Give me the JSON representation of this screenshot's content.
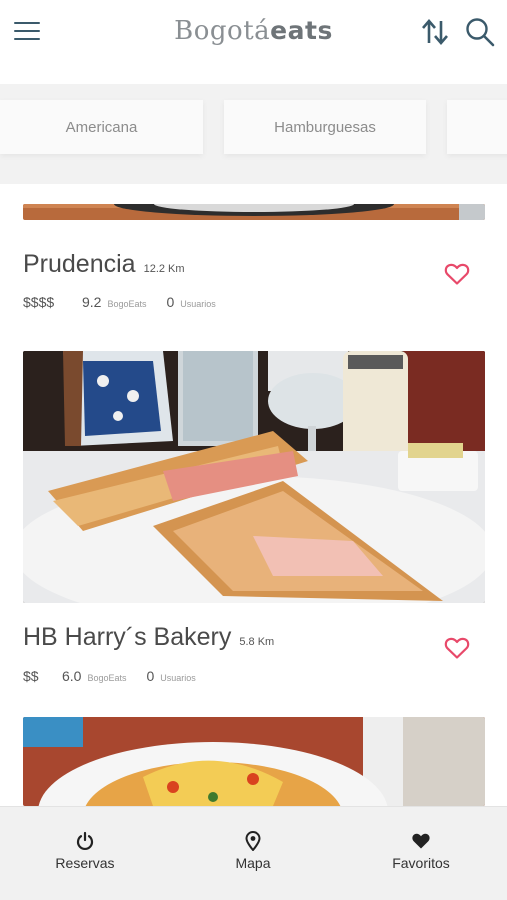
{
  "header": {
    "logo_light": "Bogotá",
    "logo_bold": "eats"
  },
  "categories": [
    {
      "label": "Americana"
    },
    {
      "label": "Hamburguesas"
    },
    {
      "label": ""
    }
  ],
  "restaurants": [
    {
      "name": "Prudencia",
      "distance": "12.2 Km",
      "price": "$$$$",
      "rating": "9.2",
      "rating_source": "BogoEats",
      "user_count": "0",
      "user_label": "Usuarios",
      "favorite": false
    },
    {
      "name": "HB Harry´s Bakery",
      "distance": "5.8 Km",
      "price": "$$",
      "rating": "6.0",
      "rating_source": "BogoEats",
      "user_count": "0",
      "user_label": "Usuarios",
      "favorite": false
    }
  ],
  "bottom_nav": [
    {
      "label": "Reservas",
      "icon": "power-icon"
    },
    {
      "label": "Mapa",
      "icon": "map-pin-icon"
    },
    {
      "label": "Favoritos",
      "icon": "heart-icon"
    }
  ],
  "colors": {
    "accent_heart": "#e8496a",
    "header_icon": "#3b5a6b",
    "logo_gray": "#8a8f93"
  }
}
